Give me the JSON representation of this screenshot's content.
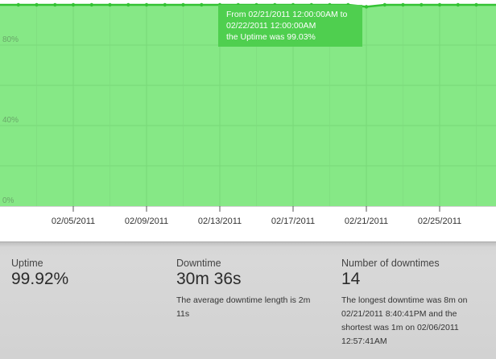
{
  "chart_data": {
    "type": "area",
    "x_labels": [
      "02/05/2011",
      "02/09/2011",
      "02/13/2011",
      "02/17/2011",
      "02/21/2011",
      "02/25/2011"
    ],
    "y_tick_labels": [
      "80%",
      "40%",
      "0%"
    ],
    "ylim": [
      0,
      100
    ],
    "grid": true,
    "series": [
      {
        "values": [
          100,
          100,
          100,
          100,
          100,
          100,
          100,
          100,
          100,
          100,
          100,
          100,
          100,
          100,
          100,
          100,
          100,
          100,
          100,
          100,
          99.03,
          100,
          100,
          100,
          100,
          100,
          100
        ]
      }
    ],
    "fill_color": "#86e886",
    "line_color": "#33c233"
  },
  "tooltip": {
    "line1": "From 02/21/2011 12:00:00AM to",
    "line2": "02/22/2011 12:00:00AM",
    "line3": "the Uptime was 99.03%"
  },
  "stats": {
    "uptime": {
      "label": "Uptime",
      "value": "99.92%"
    },
    "downtime": {
      "label": "Downtime",
      "value": "30m 36s",
      "note": "The average downtime length is 2m 11s"
    },
    "downtimes": {
      "label": "Number of downtimes",
      "value": "14",
      "note": "The longest downtime was 8m on 02/21/2011 8:40:41PM and the shortest was 1m on 02/06/2011 12:57:41AM"
    }
  }
}
